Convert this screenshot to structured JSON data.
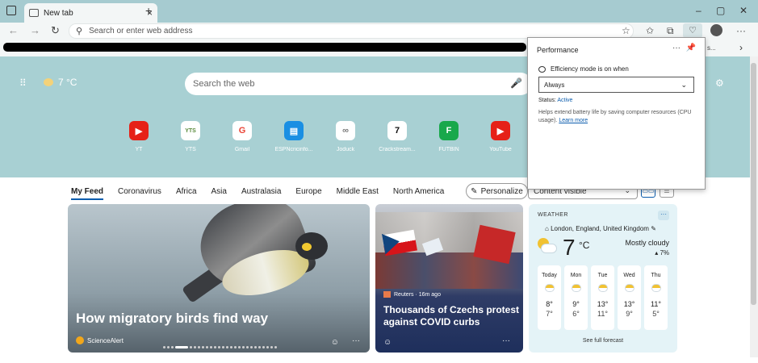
{
  "tab": {
    "title": "New tab",
    "close": "×",
    "new_tab": "+"
  },
  "window_controls": {
    "minimize": "–",
    "restore": "▢",
    "close": "✕"
  },
  "nav": {
    "back": "←",
    "forward": "→",
    "refresh": "↻"
  },
  "address": {
    "placeholder": "Search or enter web address"
  },
  "toolbar_icons": [
    "add-favorite-icon",
    "favorites-icon",
    "collections-icon",
    "performance-icon",
    "profile-icon"
  ],
  "toolbar": {
    "more": "···"
  },
  "favbar": {
    "overflow_text": "s...",
    "chevron": "›"
  },
  "hero": {
    "temperature": "7 °C",
    "search_placeholder": "Search the web",
    "quick_links": [
      {
        "label": "YT",
        "glyph": "▶",
        "color": "#e62117"
      },
      {
        "label": "YTS",
        "glyph": "YTS",
        "color": "#5a8b3c"
      },
      {
        "label": "Gmail",
        "glyph": "G",
        "color": "#ea4335"
      },
      {
        "label": "ESPNcricinfo...",
        "glyph": "▤",
        "color": "#1a8fe3"
      },
      {
        "label": "Joduck",
        "glyph": "∞",
        "color": "#777777"
      },
      {
        "label": "Crackstream...",
        "glyph": "7",
        "color": "#111111"
      },
      {
        "label": "FUTBIN",
        "glyph": "F",
        "color": "#18a84b"
      },
      {
        "label": "YouTube",
        "glyph": "▶",
        "color": "#e62117"
      }
    ]
  },
  "feed": {
    "tabs": [
      "My Feed",
      "Coronavirus",
      "Africa",
      "Asia",
      "Australasia",
      "Europe",
      "Middle East",
      "North America"
    ],
    "personalize": "Personalize",
    "content_visibility": "Content visible",
    "card1": {
      "title": "How migratory birds find way",
      "source": "ScienceAlert",
      "more": "···"
    },
    "card2": {
      "source": "Reuters · 16m ago",
      "title": "Thousands of Czechs protest against COVID curbs",
      "more": "···"
    }
  },
  "weather": {
    "heading": "WEATHER",
    "more": "···",
    "location": "London, England, United Kingdom",
    "temp": "7",
    "unit": "°C",
    "condition": "Mostly cloudy",
    "precip": "7%",
    "forecast": [
      {
        "day": "Today",
        "hi": "8°",
        "lo": "7°"
      },
      {
        "day": "Mon",
        "hi": "9°",
        "lo": "6°"
      },
      {
        "day": "Tue",
        "hi": "13°",
        "lo": "11°"
      },
      {
        "day": "Wed",
        "hi": "13°",
        "lo": "9°"
      },
      {
        "day": "Thu",
        "hi": "11°",
        "lo": "5°"
      }
    ],
    "link": "See full forecast"
  },
  "performance": {
    "title": "Performance",
    "efficiency_label": "Efficiency mode is on when",
    "selected": "Always",
    "status_label": "Status:",
    "status_value": "Active",
    "description": "Helps extend battery life by saving computer resources (CPU usage).",
    "learn_more": "Learn more"
  },
  "colors": {
    "hero_bg": "#a8d0d3",
    "titlebar_bg": "#a6cbd0",
    "accent": "#0b5cad"
  }
}
